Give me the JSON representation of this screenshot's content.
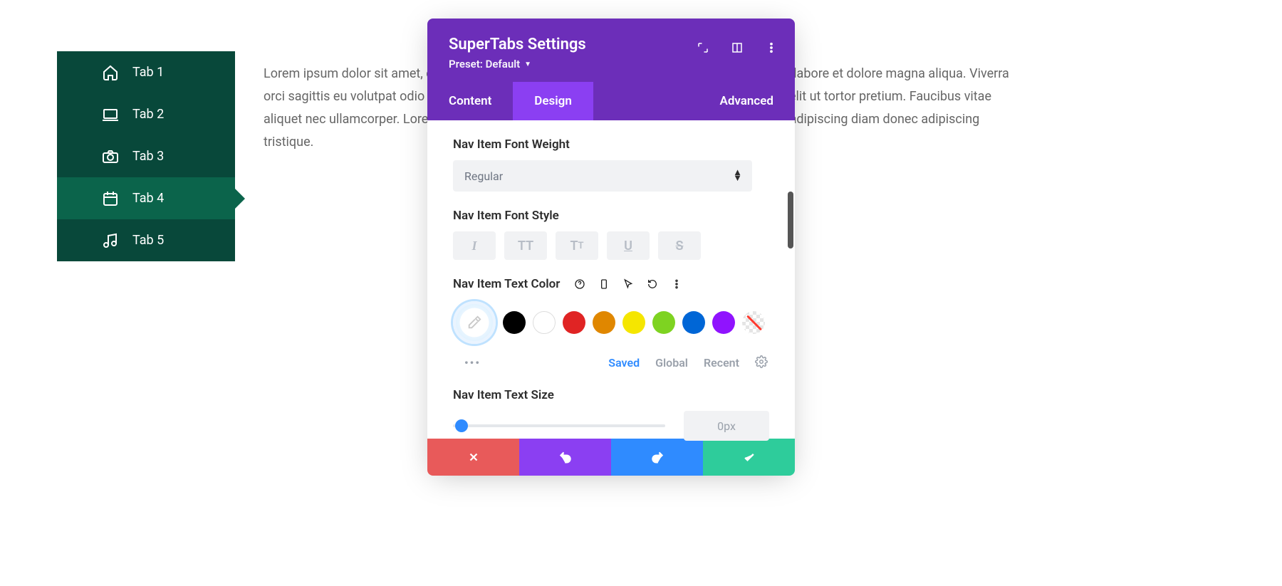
{
  "sidebar": {
    "items": [
      {
        "label": "Tab 1",
        "icon": "home-icon"
      },
      {
        "label": "Tab 2",
        "icon": "laptop-icon"
      },
      {
        "label": "Tab 3",
        "icon": "camera-icon"
      },
      {
        "label": "Tab 4",
        "icon": "calendar-icon",
        "active": true
      },
      {
        "label": "Tab 5",
        "icon": "music-icon"
      }
    ]
  },
  "body_text": "Lorem ipsum dolor sit amet, consectetur adipiscing elit, sed do eiusmod tempor incididunt ut labore et dolore magna aliqua. Viverra orci sagittis eu volutpat odio facilisis mauris sit amet. Imperdiet proin fermentum leo vel. Id velit ut tortor pretium. Faucibus vitae aliquet nec ullamcorper. Lorem ipsum dolor sit amet consectetur adipiscing elit. Aenean sed adipiscing diam donec adipiscing tristique.",
  "panel": {
    "title": "SuperTabs Settings",
    "preset_label": "Preset: Default",
    "tabs": [
      {
        "label": "Content"
      },
      {
        "label": "Design",
        "active": true
      },
      {
        "label": "Advanced"
      }
    ],
    "fields": {
      "font_weight": {
        "label": "Nav Item Font Weight",
        "value": "Regular"
      },
      "font_style": {
        "label": "Nav Item Font Style"
      },
      "text_color": {
        "label": "Nav Item Text Color"
      },
      "text_size": {
        "label": "Nav Item Text Size",
        "value": "0px"
      }
    },
    "palette": {
      "colors": [
        "#000000",
        "#ffffff",
        "#e02424",
        "#e08700",
        "#f5e600",
        "#7ed321",
        "#0066d6",
        "#9013fe",
        "transparent"
      ],
      "tabs": [
        {
          "label": "Saved",
          "active": true
        },
        {
          "label": "Global"
        },
        {
          "label": "Recent"
        }
      ]
    }
  }
}
